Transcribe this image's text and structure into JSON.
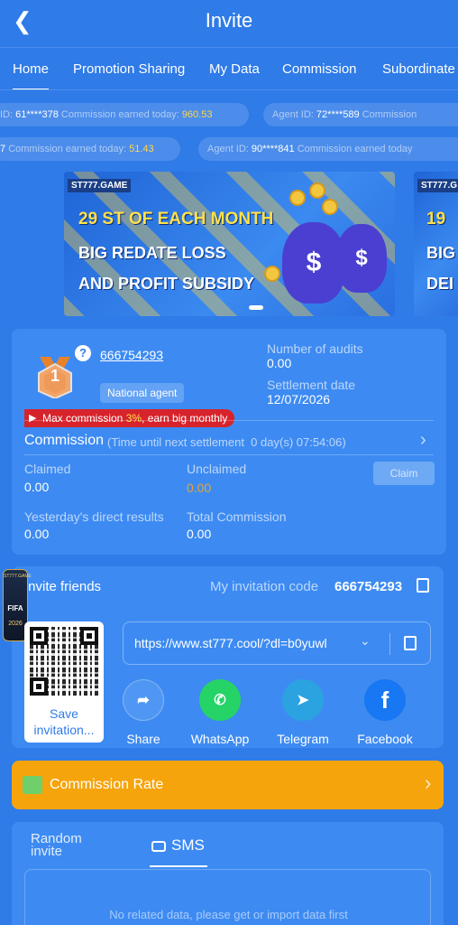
{
  "header": {
    "back_icon": "chevron-left-icon",
    "title": "Invite"
  },
  "tabs": [
    {
      "label": "Home",
      "active": true
    },
    {
      "label": "Promotion Sharing"
    },
    {
      "label": "My Data"
    },
    {
      "label": "Commission"
    },
    {
      "label": "Subordinate"
    }
  ],
  "ticker": {
    "row1": [
      {
        "id_label": "ID:",
        "id": "61****378",
        "comm_label": "Commission earned today:",
        "amount": "960.53"
      },
      {
        "id_label": "Agent ID:",
        "id": "72****589",
        "comm_label": "Commission"
      }
    ],
    "row2": [
      {
        "id": "7",
        "comm_label": "Commission earned today:",
        "amount": "51.43"
      },
      {
        "id_label": "Agent ID:",
        "id": "90****841",
        "comm_label": "Commission earned today"
      }
    ]
  },
  "banner": {
    "brand": "ST777.GAME",
    "line1": "29 ST OF EACH MONTH",
    "line2": "BIG REDATE LOSS",
    "line3": "AND PROFIT SUBSIDY",
    "next_brand": "ST777.G",
    "next_line1": "19",
    "next_line2": "BIG",
    "next_line3": "DEI"
  },
  "agent": {
    "medal_level": "1",
    "help_icon": "question-icon",
    "user_id": "666754293",
    "role": "National agent",
    "audits_label": "Number of audits",
    "audits_value": "0.00",
    "settlement_label": "Settlement date",
    "settlement_value": "12/07/2026",
    "promo_prefix": "Max commission ",
    "promo_pct": "3%",
    "promo_suffix": ", earn big monthly"
  },
  "commission": {
    "title": "Commission",
    "countdown": "(Time until next settlement  0 day(s) 07:54:06)",
    "claimed_label": "Claimed",
    "claimed_value": "0.00",
    "unclaimed_label": "Unclaimed",
    "unclaimed_value": "0.00",
    "claim_button": "Claim",
    "yesterday_label": "Yesterday's direct results",
    "yesterday_value": "0.00",
    "total_label": "Total Commission",
    "total_value": "0.00"
  },
  "invite": {
    "title": "Invite friends",
    "code_label": "My invitation code",
    "code_value": "666754293",
    "qr_caption_1": "Save",
    "qr_caption_2": "invitation...",
    "link": "https://www.st777.cool/?dl=b0yuwl",
    "share": [
      {
        "label": "Share",
        "icon": "share-icon",
        "color": "#4f97f3"
      },
      {
        "label": "WhatsApp",
        "icon": "whatsapp-icon",
        "color": "#25d366"
      },
      {
        "label": "Telegram",
        "icon": "telegram-icon",
        "color": "#2aa3e0"
      },
      {
        "label": "Facebook",
        "icon": "facebook-icon",
        "color": "#1877f2"
      }
    ]
  },
  "fifa_badge": {
    "top": "ST777.GAME",
    "text": "FIFA",
    "year": "2026"
  },
  "rate": {
    "label": "Commission Rate"
  },
  "bottom": {
    "tab1_line1": "Random",
    "tab1_line2": "invite",
    "tab2": "SMS",
    "empty": "No related data, please get or import data first"
  },
  "colors": {
    "background": "#2f7be8",
    "card": "#3d8bf2",
    "accent": "#f5a40c",
    "promo": "#d7232b"
  }
}
